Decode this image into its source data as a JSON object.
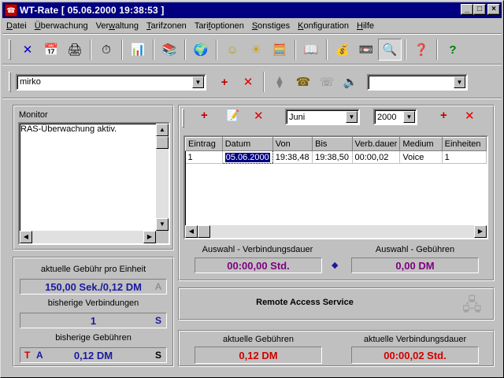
{
  "window": {
    "title": "WT-Rate [ 05.06.2000  19:38:53 ]",
    "app_icon_text": "☎",
    "controls": {
      "minimize": "_",
      "maximize": "□",
      "close": "×"
    }
  },
  "menu": [
    {
      "pre": "",
      "u": "D",
      "post": "atei"
    },
    {
      "pre": "",
      "u": "Ü",
      "post": "berwachung"
    },
    {
      "pre": "Ver",
      "u": "w",
      "post": "altung"
    },
    {
      "pre": "",
      "u": "T",
      "post": "arifzonen"
    },
    {
      "pre": "Tari",
      "u": "f",
      "post": "optionen"
    },
    {
      "pre": "",
      "u": "S",
      "post": "onstiges"
    },
    {
      "pre": "",
      "u": "K",
      "post": "onfiguration"
    },
    {
      "pre": "",
      "u": "H",
      "post": "ilfe"
    }
  ],
  "toolbar": {
    "icons": [
      "✕",
      "📅",
      "🖨",
      "⏱",
      "📊",
      "📚",
      "🌍",
      "☺",
      "☀",
      "🧮",
      "📖",
      "💰",
      "📼",
      "🔍",
      "❓",
      "?"
    ]
  },
  "user_bar": {
    "user_value": "mirko",
    "add": "+",
    "delete": "✕",
    "right_combo_value": ""
  },
  "monitor": {
    "label": "Monitor",
    "lines": [
      "RAS-Überwachung aktiv."
    ]
  },
  "left_panel": {
    "fee_per_unit_label": "aktuelle Gebühr pro Einheit",
    "fee_per_unit_value": "150,00 Sek./0,12 DM",
    "fee_per_unit_flag": "A",
    "prev_connections_label": "bisherige Verbindungen",
    "prev_connections_value": "1",
    "prev_connections_flag": "S",
    "prev_fees_label": "bisherige Gebühren",
    "prev_fees_value": "0,12 DM",
    "prev_fees_flag_t": "T",
    "prev_fees_flag_a": "A",
    "prev_fees_flag_s": "S"
  },
  "log": {
    "month": "Juni",
    "year": "2000",
    "columns": [
      "Eintrag",
      "Datum",
      "Von",
      "Bis",
      "Verb.dauer",
      "Medium",
      "Einheiten"
    ],
    "rows": [
      [
        "1",
        "05.06.2000",
        "19:38,48",
        "19:38,50",
        "00:00,02",
        "Voice",
        "1"
      ]
    ]
  },
  "selection": {
    "duration_label": "Auswahl - Verbindungsdauer",
    "duration_value": "00:00,00 Std.",
    "fees_label": "Auswahl - Gebühren",
    "fees_value": "0,00 DM"
  },
  "service": {
    "name": "Remote Access Service"
  },
  "current": {
    "fees_label": "aktuelle Gebühren",
    "fees_value": "0,12 DM",
    "duration_label": "aktuelle Verbindungsdauer",
    "duration_value": "00:00,02 Std."
  },
  "colors": {
    "title_bg": "#000080",
    "blue_value": "#1a1aa0",
    "red_value": "#d00000",
    "flag_grey": "#808080"
  }
}
